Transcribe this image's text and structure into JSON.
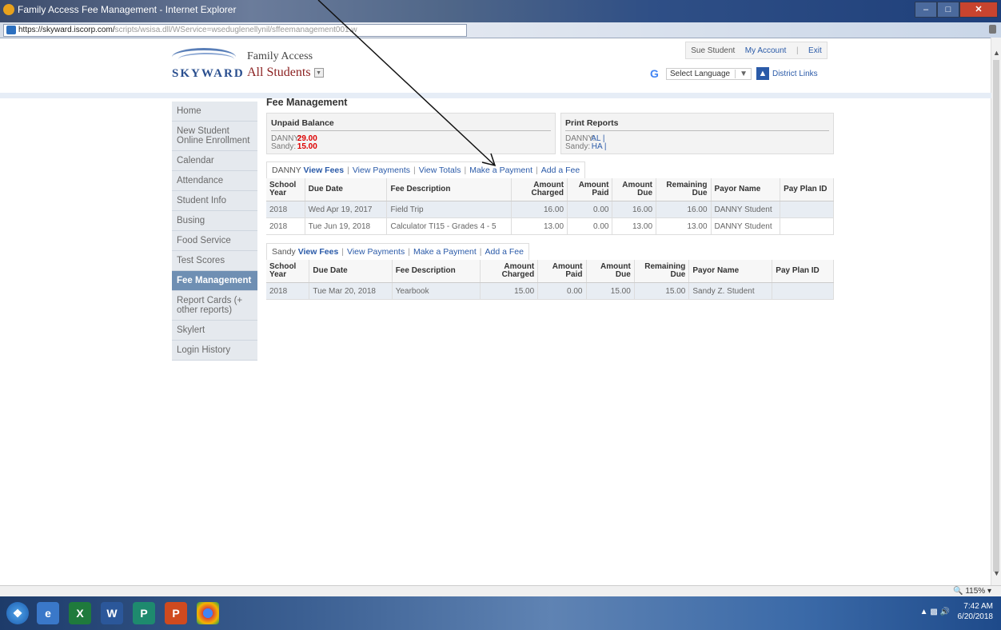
{
  "window": {
    "title": "Family Access Fee Management - Internet Explorer"
  },
  "address": {
    "url_main": "https://skyward.iscorp.com/",
    "url_rest": "scripts/wsisa.dll/WService=wseduglenellynil/sffeemanagement001.w"
  },
  "header": {
    "logo_text": "SKYWARD",
    "app_title": "Family Access",
    "student_selector": "All Students",
    "user_name": "Sue Student",
    "my_account": "My Account",
    "exit": "Exit",
    "select_language": "Select Language",
    "district_links": "District Links"
  },
  "nav": [
    {
      "label": "Home",
      "active": false
    },
    {
      "label": "New Student Online Enrollment",
      "active": false
    },
    {
      "label": "Calendar",
      "active": false
    },
    {
      "label": "Attendance",
      "active": false
    },
    {
      "label": "Student Info",
      "active": false
    },
    {
      "label": "Busing",
      "active": false
    },
    {
      "label": "Food Service",
      "active": false
    },
    {
      "label": "Test Scores",
      "active": false
    },
    {
      "label": "Fee Management",
      "active": true
    },
    {
      "label": "Report Cards (+ other reports)",
      "active": false
    },
    {
      "label": "Skylert",
      "active": false
    },
    {
      "label": "Login History",
      "active": false
    }
  ],
  "main": {
    "title": "Fee Management",
    "unpaid": {
      "head": "Unpaid Balance",
      "rows": [
        {
          "name": "DANNY:",
          "amount": "29.00"
        },
        {
          "name": "Sandy:",
          "amount": "15.00"
        }
      ]
    },
    "print": {
      "head": "Print Reports",
      "rows": [
        {
          "name": "DANNY:",
          "link": "AL |"
        },
        {
          "name": "Sandy:",
          "link": "HA |"
        }
      ]
    },
    "headers": [
      "School Year",
      "Due Date",
      "Fee Description",
      "Amount Charged",
      "Amount Paid",
      "Amount Due",
      "Remaining Due",
      "Payor Name",
      "Pay Plan ID"
    ],
    "danny": {
      "student": "DANNY",
      "tabs": [
        "View Fees",
        "View Payments",
        "View Totals",
        "Make a Payment",
        "Add a Fee"
      ],
      "rows": [
        [
          "2018",
          "Wed Apr 19, 2017",
          "Field Trip",
          "16.00",
          "0.00",
          "16.00",
          "16.00",
          "DANNY Student",
          ""
        ],
        [
          "2018",
          "Tue Jun 19, 2018",
          "Calculator TI15 - Grades 4 - 5",
          "13.00",
          "0.00",
          "13.00",
          "13.00",
          "DANNY Student",
          ""
        ]
      ]
    },
    "sandy": {
      "student": "Sandy",
      "tabs": [
        "View Fees",
        "View Payments",
        "Make a Payment",
        "Add a Fee"
      ],
      "rows": [
        [
          "2018",
          "Tue Mar 20, 2018",
          "Yearbook",
          "15.00",
          "0.00",
          "15.00",
          "15.00",
          "Sandy Z. Student",
          ""
        ]
      ]
    }
  },
  "status": {
    "zoom": "115%"
  },
  "tray": {
    "time": "7:42 AM",
    "date": "6/20/2018"
  }
}
